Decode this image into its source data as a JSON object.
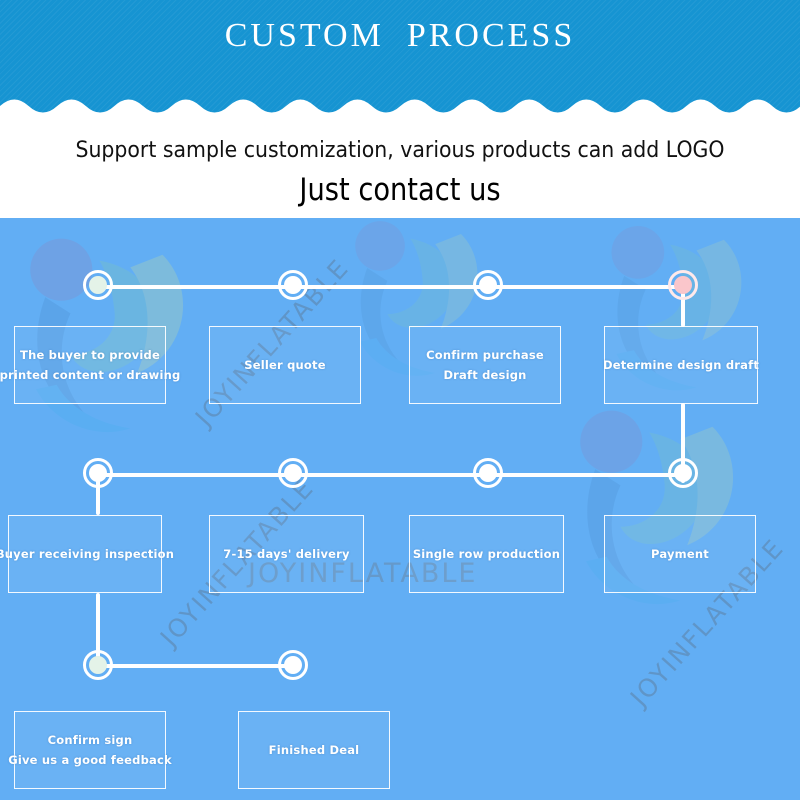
{
  "header": {
    "title": "CUSTOM  PROCESS",
    "background_color": "#1694d2"
  },
  "subtitle": {
    "line1": "Support sample customization, various products can add LOGO",
    "line2": "Just contact us"
  },
  "panel": {
    "background_color": "#62aef4",
    "watermark_text": "JOYINFLATABLE"
  },
  "flow": {
    "rows": [
      {
        "nodes": [
          {
            "name": "node-step-1",
            "style": "mint"
          },
          {
            "name": "node-step-2",
            "style": "plain"
          },
          {
            "name": "node-step-3",
            "style": "plain"
          },
          {
            "name": "node-step-4",
            "style": "pink"
          }
        ],
        "boxes": [
          {
            "name": "box-step-1",
            "lines": [
              "The buyer to provide",
              "printed content or drawing"
            ]
          },
          {
            "name": "box-step-2",
            "lines": [
              "Seller quote"
            ]
          },
          {
            "name": "box-step-3",
            "lines": [
              "Confirm purchase",
              "Draft design"
            ]
          },
          {
            "name": "box-step-4",
            "lines": [
              "Determine design draft"
            ]
          }
        ]
      },
      {
        "nodes": [
          {
            "name": "node-step-8",
            "style": "plain"
          },
          {
            "name": "node-step-7",
            "style": "plain"
          },
          {
            "name": "node-step-6",
            "style": "plain"
          },
          {
            "name": "node-step-5",
            "style": "plain"
          }
        ],
        "boxes": [
          {
            "name": "box-step-8",
            "lines": [
              "Buyer receiving inspection"
            ]
          },
          {
            "name": "box-step-7",
            "lines": [
              "7-15 days' delivery"
            ]
          },
          {
            "name": "box-step-6",
            "lines": [
              "Single row production"
            ]
          },
          {
            "name": "box-step-5",
            "lines": [
              "Payment"
            ]
          }
        ]
      },
      {
        "nodes": [
          {
            "name": "node-step-9",
            "style": "mint"
          },
          {
            "name": "node-step-10",
            "style": "plain"
          }
        ],
        "boxes": [
          {
            "name": "box-step-9",
            "lines": [
              "Confirm sign",
              "Give us a good feedback"
            ]
          },
          {
            "name": "box-step-10",
            "lines": [
              "Finished Deal"
            ]
          }
        ]
      }
    ]
  },
  "colors": {
    "accent_blue": "#1694d2",
    "panel_blue": "#62aef4",
    "node_pink": "#fac6cb",
    "node_mint": "#e4f3e8",
    "line_white": "#ffffff"
  }
}
